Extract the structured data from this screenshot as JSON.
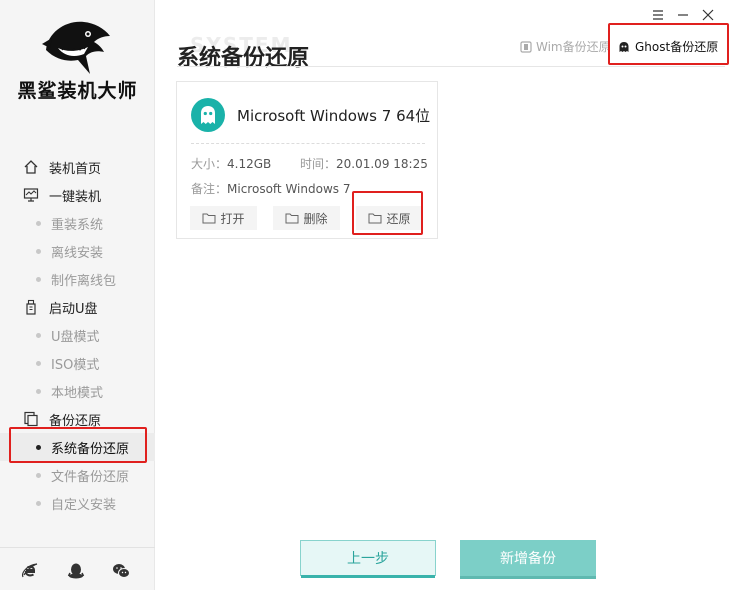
{
  "app": {
    "brand": "黑鲨装机大师"
  },
  "sidebar": {
    "items": [
      {
        "label": "装机首页",
        "type": "main",
        "icon": "home-icon"
      },
      {
        "label": "一键装机",
        "type": "main",
        "icon": "monitor-icon"
      },
      {
        "label": "重装系统",
        "type": "sub"
      },
      {
        "label": "离线安装",
        "type": "sub"
      },
      {
        "label": "制作离线包",
        "type": "sub"
      },
      {
        "label": "启动U盘",
        "type": "main",
        "icon": "usb-icon"
      },
      {
        "label": "U盘模式",
        "type": "sub"
      },
      {
        "label": "ISO模式",
        "type": "sub"
      },
      {
        "label": "本地模式",
        "type": "sub"
      },
      {
        "label": "备份还原",
        "type": "main",
        "icon": "backup-icon"
      },
      {
        "label": "系统备份还原",
        "type": "sub",
        "active": true
      },
      {
        "label": "文件备份还原",
        "type": "sub"
      },
      {
        "label": "自定义安装",
        "type": "sub"
      }
    ],
    "bottom_icons": [
      "ie-icon",
      "qq-icon",
      "wechat-icon"
    ]
  },
  "header": {
    "watermark": "SYSTEM",
    "title": "系统备份还原",
    "tabs": [
      {
        "label": "Wim备份还原",
        "active": false
      },
      {
        "label": "Ghost备份还原",
        "active": true
      }
    ]
  },
  "card": {
    "title": "Microsoft Windows 7 64位",
    "size_label": "大小：",
    "size_value": "4.12GB",
    "time_label": "时间：",
    "time_value": "20.01.09 18:25",
    "note_label": "备注：",
    "note_value": "Microsoft Windows 7",
    "buttons": {
      "open": "打开",
      "delete": "删除",
      "restore": "还原"
    }
  },
  "footer": {
    "prev": "上一步",
    "new_backup": "新增备份"
  },
  "colors": {
    "accent": "#2aa8a0",
    "highlight": "#e0201e"
  }
}
